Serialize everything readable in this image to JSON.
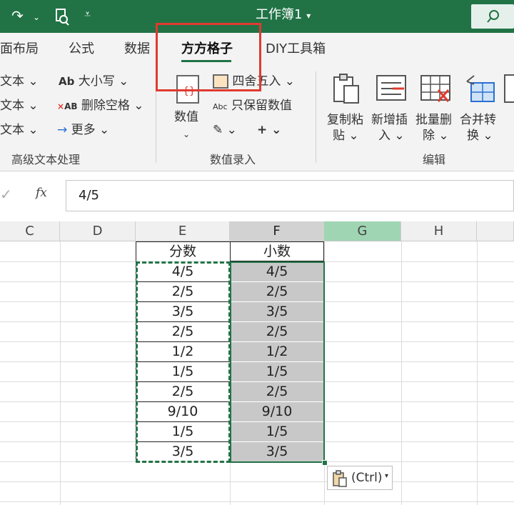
{
  "window": {
    "title": "工作簿1"
  },
  "tabs": [
    {
      "label": "面布局"
    },
    {
      "label": "公式"
    },
    {
      "label": "数据"
    },
    {
      "label": "方方格子",
      "active": true
    },
    {
      "label": "DIY工具箱"
    }
  ],
  "ribbon": {
    "text_group": {
      "items": [
        "文本",
        "文本",
        "文本"
      ],
      "case_label": "大小写",
      "remove_space_label": "删除空格",
      "more_label": "更多",
      "group_label": "高级文本处理"
    },
    "number_group": {
      "value_button": "数值",
      "round_label": "四舍五入",
      "keep_value_label": "只保留数值",
      "group_label": "数值录入"
    },
    "edit_group": {
      "buttons": [
        {
          "line1": "复制粘",
          "line2": "贴"
        },
        {
          "line1": "新增插",
          "line2": "入"
        },
        {
          "line1": "批量删",
          "line2": "除"
        },
        {
          "line1": "合并转",
          "line2": "换"
        }
      ],
      "group_label": "编辑"
    }
  },
  "formula_bar": {
    "fx_label": "fx",
    "value": "4/5"
  },
  "grid": {
    "columns": [
      "C",
      "D",
      "E",
      "F",
      "G",
      "H"
    ],
    "headers": {
      "E": "分数",
      "F": "小数"
    },
    "rows": [
      {
        "E": "4/5",
        "F": "4/5"
      },
      {
        "E": "2/5",
        "F": "2/5"
      },
      {
        "E": "3/5",
        "F": "3/5"
      },
      {
        "E": "2/5",
        "F": "2/5"
      },
      {
        "E": "1/2",
        "F": "1/2"
      },
      {
        "E": "1/5",
        "F": "1/5"
      },
      {
        "E": "2/5",
        "F": "2/5"
      },
      {
        "E": "9/10",
        "F": "9/10"
      },
      {
        "E": "1/5",
        "F": "1/5"
      },
      {
        "E": "3/5",
        "F": "3/5"
      }
    ]
  },
  "paste_options": {
    "label": "(Ctrl)"
  },
  "colors": {
    "accent": "#217346",
    "highlight": "#e03a2f",
    "selected_fill": "#c8c8c8"
  }
}
